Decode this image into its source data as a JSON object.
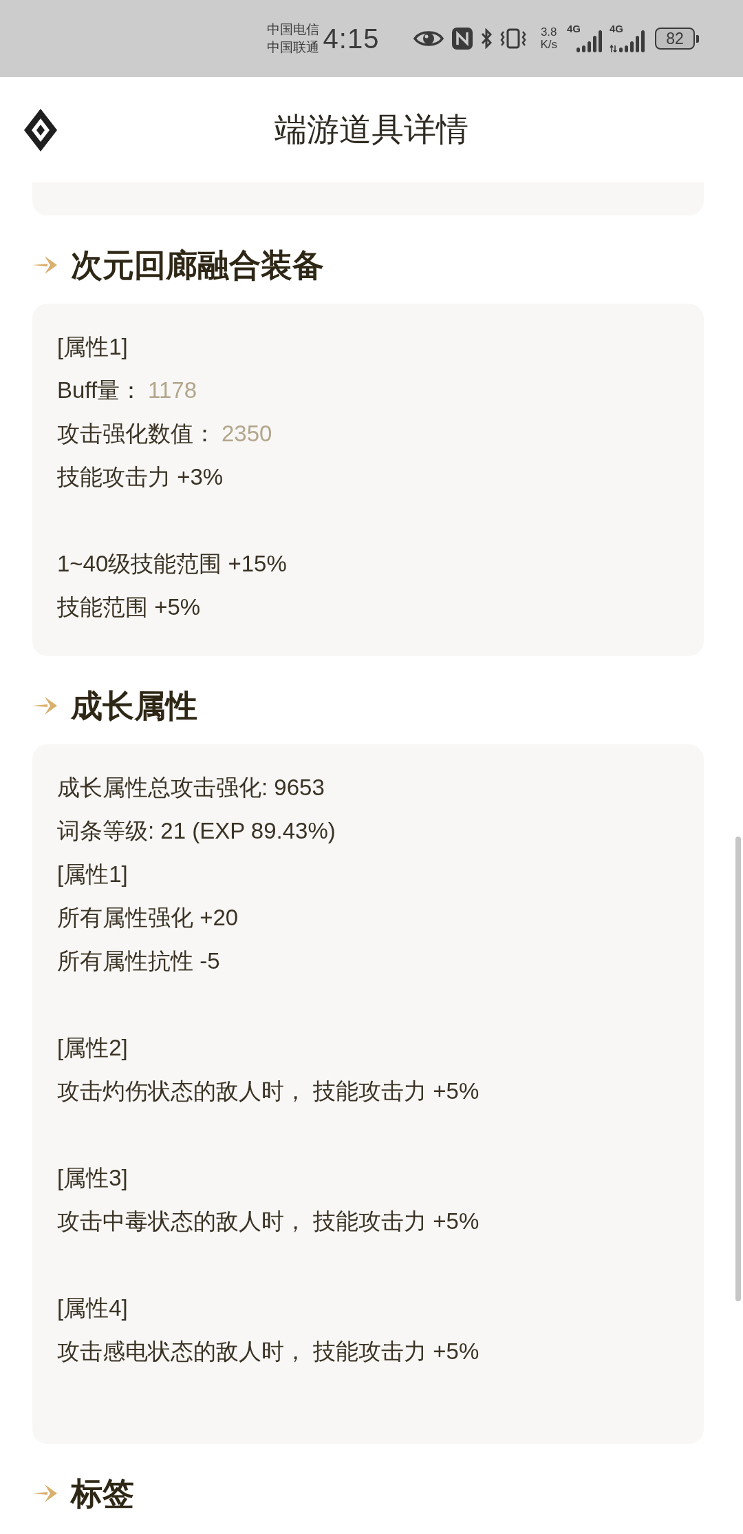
{
  "status_bar": {
    "carriers": [
      "中国电信",
      "中国联通"
    ],
    "time": "4:15",
    "net_speed": [
      "3.8",
      "K/s"
    ],
    "signals": [
      {
        "label": "4G",
        "kind": "plain"
      },
      {
        "label": "4G",
        "kind": "transfer"
      }
    ],
    "battery": "82"
  },
  "header": {
    "title": "端游道具详情"
  },
  "sections": [
    {
      "title": "次元回廊融合装备",
      "lines": [
        {
          "kind": "text",
          "text": "[属性1]"
        },
        {
          "kind": "pair",
          "label": "Buff量：",
          "value": "1178"
        },
        {
          "kind": "pair",
          "label": "攻击强化数值：",
          "value": "2350"
        },
        {
          "kind": "text",
          "text": "技能攻击力 +3%"
        },
        {
          "kind": "blank"
        },
        {
          "kind": "text",
          "text": "1~40级技能范围 +15%"
        },
        {
          "kind": "text",
          "text": "技能范围 +5%"
        }
      ]
    },
    {
      "title": "成长属性",
      "lines": [
        {
          "kind": "text",
          "text": "成长属性总攻击强化: 9653"
        },
        {
          "kind": "text",
          "text": "词条等级: 21 (EXP 89.43%)"
        },
        {
          "kind": "text",
          "text": "[属性1]"
        },
        {
          "kind": "text",
          "text": "所有属性强化 +20"
        },
        {
          "kind": "text",
          "text": "所有属性抗性 -5"
        },
        {
          "kind": "blank"
        },
        {
          "kind": "text",
          "text": "[属性2]"
        },
        {
          "kind": "text",
          "text": "攻击灼伤状态的敌人时， 技能攻击力 +5%"
        },
        {
          "kind": "blank"
        },
        {
          "kind": "text",
          "text": "[属性3]"
        },
        {
          "kind": "text",
          "text": "攻击中毒状态的敌人时， 技能攻击力 +5%"
        },
        {
          "kind": "blank"
        },
        {
          "kind": "text",
          "text": "[属性4]"
        },
        {
          "kind": "text",
          "text": "攻击感电状态的敌人时， 技能攻击力 +5%"
        },
        {
          "kind": "blank"
        }
      ]
    },
    {
      "title": "标签"
    }
  ]
}
